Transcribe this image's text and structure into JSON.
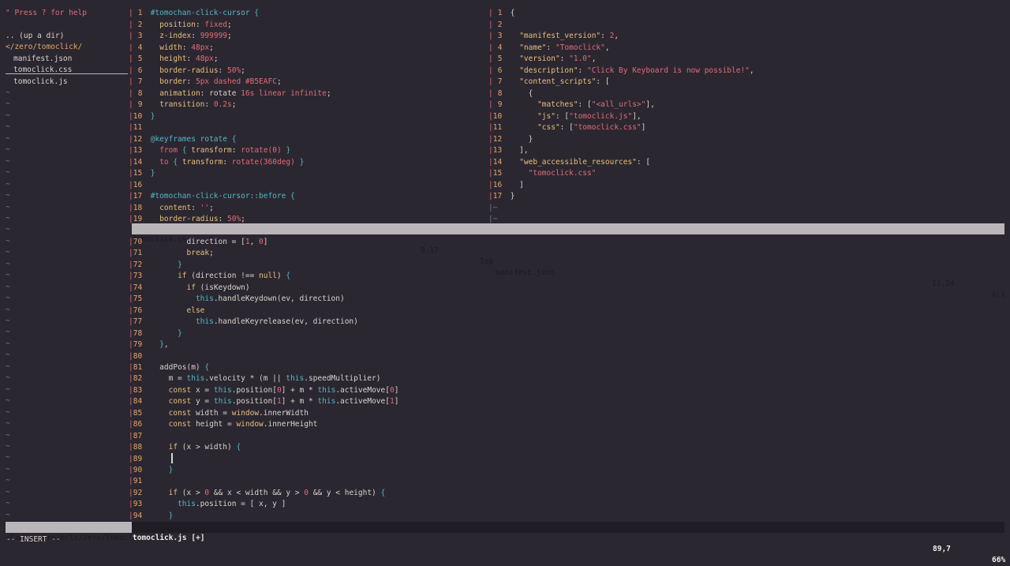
{
  "tree": {
    "help": "\" Press ? for help",
    "up_dir": ".. (up a dir)",
    "current_dir": "</zero/tomoclick/",
    "files": [
      "manifest.json",
      "tomoclick.css",
      "tomoclick.js"
    ],
    "tilde": "~"
  },
  "css_pane": {
    "lines": [
      {
        "n": "1",
        "t": [
          [
            "tk-sel",
            "#tomochan-click-cursor "
          ],
          [
            "tk-brace",
            "{"
          ]
        ]
      },
      {
        "n": "2",
        "t": [
          [
            "tk-plain",
            "  "
          ],
          [
            "tk-prop",
            "position"
          ],
          [
            "tk-punc",
            ": "
          ],
          [
            "tk-str",
            "fixed"
          ],
          [
            "tk-punc",
            ";"
          ]
        ]
      },
      {
        "n": "3",
        "t": [
          [
            "tk-plain",
            "  "
          ],
          [
            "tk-prop",
            "z-index"
          ],
          [
            "tk-punc",
            ": "
          ],
          [
            "tk-num",
            "999999"
          ],
          [
            "tk-punc",
            ";"
          ]
        ]
      },
      {
        "n": "4",
        "t": [
          [
            "tk-plain",
            "  "
          ],
          [
            "tk-prop",
            "width"
          ],
          [
            "tk-punc",
            ": "
          ],
          [
            "tk-num",
            "48px"
          ],
          [
            "tk-punc",
            ";"
          ]
        ]
      },
      {
        "n": "5",
        "t": [
          [
            "tk-plain",
            "  "
          ],
          [
            "tk-prop",
            "height"
          ],
          [
            "tk-punc",
            ": "
          ],
          [
            "tk-num",
            "48px"
          ],
          [
            "tk-punc",
            ";"
          ]
        ]
      },
      {
        "n": "6",
        "t": [
          [
            "tk-plain",
            "  "
          ],
          [
            "tk-prop",
            "border-radius"
          ],
          [
            "tk-punc",
            ": "
          ],
          [
            "tk-num",
            "50%"
          ],
          [
            "tk-punc",
            ";"
          ]
        ]
      },
      {
        "n": "7",
        "t": [
          [
            "tk-plain",
            "  "
          ],
          [
            "tk-prop",
            "border"
          ],
          [
            "tk-punc",
            ": "
          ],
          [
            "tk-num",
            "5px"
          ],
          [
            "tk-str",
            " dashed #B5EAFC"
          ],
          [
            "tk-punc",
            ";"
          ]
        ]
      },
      {
        "n": "8",
        "t": [
          [
            "tk-plain",
            "  "
          ],
          [
            "tk-prop",
            "animation"
          ],
          [
            "tk-punc",
            ": rotate "
          ],
          [
            "tk-num",
            "16s"
          ],
          [
            "tk-str",
            " linear infinite"
          ],
          [
            "tk-punc",
            ";"
          ]
        ]
      },
      {
        "n": "9",
        "t": [
          [
            "tk-plain",
            "  "
          ],
          [
            "tk-prop",
            "transition"
          ],
          [
            "tk-punc",
            ": "
          ],
          [
            "tk-num",
            "0.2s"
          ],
          [
            "tk-punc",
            ";"
          ]
        ]
      },
      {
        "n": "10",
        "t": [
          [
            "tk-brace",
            "}"
          ]
        ]
      },
      {
        "n": "11",
        "t": []
      },
      {
        "n": "12",
        "t": [
          [
            "tk-fn",
            "@keyframes rotate "
          ],
          [
            "tk-brace",
            "{"
          ]
        ]
      },
      {
        "n": "13",
        "t": [
          [
            "tk-plain",
            "  "
          ],
          [
            "tk-str",
            "from"
          ],
          [
            "tk-plain",
            " "
          ],
          [
            "tk-brace",
            "{"
          ],
          [
            "tk-plain",
            " "
          ],
          [
            "tk-prop",
            "transform"
          ],
          [
            "tk-punc",
            ": "
          ],
          [
            "tk-str",
            "rotate(0)"
          ],
          [
            "tk-plain",
            " "
          ],
          [
            "tk-brace",
            "}"
          ]
        ]
      },
      {
        "n": "14",
        "t": [
          [
            "tk-plain",
            "  "
          ],
          [
            "tk-str",
            "to"
          ],
          [
            "tk-plain",
            " "
          ],
          [
            "tk-brace",
            "{"
          ],
          [
            "tk-plain",
            " "
          ],
          [
            "tk-prop",
            "transform"
          ],
          [
            "tk-punc",
            ": "
          ],
          [
            "tk-str",
            "rotate(360deg)"
          ],
          [
            "tk-plain",
            " "
          ],
          [
            "tk-brace",
            "}"
          ]
        ]
      },
      {
        "n": "15",
        "t": [
          [
            "tk-brace",
            "}"
          ]
        ]
      },
      {
        "n": "16",
        "t": []
      },
      {
        "n": "17",
        "t": [
          [
            "tk-sel",
            "#tomochan-click-cursor::before "
          ],
          [
            "tk-brace",
            "{"
          ]
        ]
      },
      {
        "n": "18",
        "t": [
          [
            "tk-plain",
            "  "
          ],
          [
            "tk-prop",
            "content"
          ],
          [
            "tk-punc",
            ": "
          ],
          [
            "tk-str",
            "''"
          ],
          [
            "tk-punc",
            ";"
          ]
        ]
      },
      {
        "n": "19",
        "t": [
          [
            "tk-plain",
            "  "
          ],
          [
            "tk-prop",
            "border-radius"
          ],
          [
            "tk-punc",
            ": "
          ],
          [
            "tk-num",
            "50%"
          ],
          [
            "tk-punc",
            ";"
          ]
        ]
      }
    ]
  },
  "json_pane": {
    "lines": [
      {
        "n": "1",
        "t": [
          [
            "tk-punc",
            "{"
          ]
        ]
      },
      {
        "n": "2",
        "t": []
      },
      {
        "n": "3",
        "t": [
          [
            "tk-plain",
            "  "
          ],
          [
            "tk-prop",
            "\"manifest_version\""
          ],
          [
            "tk-punc",
            ": "
          ],
          [
            "tk-num",
            "2"
          ],
          [
            "tk-punc",
            ","
          ]
        ]
      },
      {
        "n": "4",
        "t": [
          [
            "tk-plain",
            "  "
          ],
          [
            "tk-prop",
            "\"name\""
          ],
          [
            "tk-punc",
            ": "
          ],
          [
            "tk-str",
            "\"Tomoclick\""
          ],
          [
            "tk-punc",
            ","
          ]
        ]
      },
      {
        "n": "5",
        "t": [
          [
            "tk-plain",
            "  "
          ],
          [
            "tk-prop",
            "\"version\""
          ],
          [
            "tk-punc",
            ": "
          ],
          [
            "tk-str",
            "\"1.0\""
          ],
          [
            "tk-punc",
            ","
          ]
        ]
      },
      {
        "n": "6",
        "t": [
          [
            "tk-plain",
            "  "
          ],
          [
            "tk-prop",
            "\"description\""
          ],
          [
            "tk-punc",
            ": "
          ],
          [
            "tk-str",
            "\"Click By Keyboard is now possible!\""
          ],
          [
            "tk-punc",
            ","
          ]
        ]
      },
      {
        "n": "7",
        "t": [
          [
            "tk-plain",
            "  "
          ],
          [
            "tk-prop",
            "\"content_scripts\""
          ],
          [
            "tk-punc",
            ": ["
          ]
        ]
      },
      {
        "n": "8",
        "t": [
          [
            "tk-plain",
            "    {"
          ]
        ]
      },
      {
        "n": "9",
        "t": [
          [
            "tk-plain",
            "      "
          ],
          [
            "tk-prop",
            "\"matches\""
          ],
          [
            "tk-punc",
            ": ["
          ],
          [
            "tk-str",
            "\"<all_urls>\""
          ],
          [
            "tk-punc",
            "],"
          ]
        ]
      },
      {
        "n": "10",
        "t": [
          [
            "tk-plain",
            "      "
          ],
          [
            "tk-prop",
            "\"js\""
          ],
          [
            "tk-punc",
            ": ["
          ],
          [
            "tk-str",
            "\"tomoclick.js\""
          ],
          [
            "tk-punc",
            "],"
          ]
        ]
      },
      {
        "n": "11",
        "t": [
          [
            "tk-plain",
            "      "
          ],
          [
            "tk-prop",
            "\"css\""
          ],
          [
            "tk-punc",
            ": ["
          ],
          [
            "tk-str",
            "\"tomoclick.css\""
          ],
          [
            "tk-punc",
            "]"
          ]
        ]
      },
      {
        "n": "12",
        "t": [
          [
            "tk-plain",
            "    }"
          ]
        ]
      },
      {
        "n": "13",
        "t": [
          [
            "tk-plain",
            "  ],"
          ]
        ]
      },
      {
        "n": "14",
        "t": [
          [
            "tk-plain",
            "  "
          ],
          [
            "tk-prop",
            "\"web_accessible_resources\""
          ],
          [
            "tk-punc",
            ": ["
          ]
        ]
      },
      {
        "n": "15",
        "t": [
          [
            "tk-plain",
            "    "
          ],
          [
            "tk-str",
            "\"tomoclick.css\""
          ]
        ]
      },
      {
        "n": "16",
        "t": [
          [
            "tk-plain",
            "  ]"
          ]
        ]
      },
      {
        "n": "17",
        "t": [
          [
            "tk-punc",
            "}"
          ]
        ]
      }
    ],
    "tilde_count": 2
  },
  "js_pane": {
    "lines": [
      {
        "n": "70",
        "t": [
          [
            "tk-plain",
            "        direction = ["
          ],
          [
            "tk-num",
            "1"
          ],
          [
            "tk-plain",
            ", "
          ],
          [
            "tk-num",
            "0"
          ],
          [
            "tk-plain",
            "]"
          ]
        ]
      },
      {
        "n": "71",
        "t": [
          [
            "tk-plain",
            "        "
          ],
          [
            "tk-kw",
            "break"
          ],
          [
            "tk-plain",
            ";"
          ]
        ]
      },
      {
        "n": "72",
        "t": [
          [
            "tk-plain",
            "      "
          ],
          [
            "tk-brace",
            "}"
          ]
        ]
      },
      {
        "n": "73",
        "t": [
          [
            "tk-plain",
            "      "
          ],
          [
            "tk-kw",
            "if"
          ],
          [
            "tk-plain",
            " (direction !== "
          ],
          [
            "tk-kw",
            "null"
          ],
          [
            "tk-plain",
            ") "
          ],
          [
            "tk-brace",
            "{"
          ]
        ]
      },
      {
        "n": "74",
        "t": [
          [
            "tk-plain",
            "        "
          ],
          [
            "tk-kw",
            "if"
          ],
          [
            "tk-plain",
            " (isKeydown)"
          ]
        ]
      },
      {
        "n": "75",
        "t": [
          [
            "tk-plain",
            "          "
          ],
          [
            "tk-this",
            "this"
          ],
          [
            "tk-plain",
            ".handleKeydown(ev, direction)"
          ]
        ]
      },
      {
        "n": "76",
        "t": [
          [
            "tk-plain",
            "        "
          ],
          [
            "tk-kw",
            "else"
          ]
        ]
      },
      {
        "n": "77",
        "t": [
          [
            "tk-plain",
            "          "
          ],
          [
            "tk-this",
            "this"
          ],
          [
            "tk-plain",
            ".handleKeyrelease(ev, direction)"
          ]
        ]
      },
      {
        "n": "78",
        "t": [
          [
            "tk-plain",
            "      "
          ],
          [
            "tk-brace",
            "}"
          ]
        ]
      },
      {
        "n": "79",
        "t": [
          [
            "tk-plain",
            "  "
          ],
          [
            "tk-brace",
            "}"
          ],
          [
            "tk-plain",
            ","
          ]
        ]
      },
      {
        "n": "80",
        "t": []
      },
      {
        "n": "81",
        "t": [
          [
            "tk-plain",
            "  addPos(m) "
          ],
          [
            "tk-brace",
            "{"
          ]
        ]
      },
      {
        "n": "82",
        "t": [
          [
            "tk-plain",
            "    m = "
          ],
          [
            "tk-this",
            "this"
          ],
          [
            "tk-plain",
            ".velocity * (m || "
          ],
          [
            "tk-this",
            "this"
          ],
          [
            "tk-plain",
            ".speedMultiplier)"
          ]
        ]
      },
      {
        "n": "83",
        "t": [
          [
            "tk-plain",
            "    "
          ],
          [
            "tk-kw",
            "const"
          ],
          [
            "tk-plain",
            " x = "
          ],
          [
            "tk-this",
            "this"
          ],
          [
            "tk-plain",
            ".position["
          ],
          [
            "tk-num",
            "0"
          ],
          [
            "tk-plain",
            "] + m * "
          ],
          [
            "tk-this",
            "this"
          ],
          [
            "tk-plain",
            ".activeMove["
          ],
          [
            "tk-num",
            "0"
          ],
          [
            "tk-plain",
            "]"
          ]
        ]
      },
      {
        "n": "84",
        "t": [
          [
            "tk-plain",
            "    "
          ],
          [
            "tk-kw",
            "const"
          ],
          [
            "tk-plain",
            " y = "
          ],
          [
            "tk-this",
            "this"
          ],
          [
            "tk-plain",
            ".position["
          ],
          [
            "tk-num",
            "1"
          ],
          [
            "tk-plain",
            "] + m * "
          ],
          [
            "tk-this",
            "this"
          ],
          [
            "tk-plain",
            ".activeMove["
          ],
          [
            "tk-num",
            "1"
          ],
          [
            "tk-plain",
            "]"
          ]
        ]
      },
      {
        "n": "85",
        "t": [
          [
            "tk-plain",
            "    "
          ],
          [
            "tk-kw",
            "const"
          ],
          [
            "tk-plain",
            " width = "
          ],
          [
            "tk-kw",
            "window"
          ],
          [
            "tk-plain",
            ".innerWidth"
          ]
        ]
      },
      {
        "n": "86",
        "t": [
          [
            "tk-plain",
            "    "
          ],
          [
            "tk-kw",
            "const"
          ],
          [
            "tk-plain",
            " height = "
          ],
          [
            "tk-kw",
            "window"
          ],
          [
            "tk-plain",
            ".innerHeight"
          ]
        ]
      },
      {
        "n": "87",
        "t": []
      },
      {
        "n": "88",
        "t": [
          [
            "tk-plain",
            "    "
          ],
          [
            "tk-kw",
            "if"
          ],
          [
            "tk-plain",
            " (x > width) "
          ],
          [
            "tk-brace",
            "{"
          ]
        ]
      },
      {
        "n": "89",
        "t": []
      },
      {
        "n": "90",
        "t": [
          [
            "tk-plain",
            "    "
          ],
          [
            "tk-brace",
            "}"
          ]
        ]
      },
      {
        "n": "91",
        "t": []
      },
      {
        "n": "92",
        "t": [
          [
            "tk-plain",
            "    "
          ],
          [
            "tk-kw",
            "if"
          ],
          [
            "tk-plain",
            " (x > "
          ],
          [
            "tk-num",
            "0"
          ],
          [
            "tk-plain",
            " && x < width && y > "
          ],
          [
            "tk-num",
            "0"
          ],
          [
            "tk-plain",
            " && y < height) "
          ],
          [
            "tk-brace",
            "{"
          ]
        ]
      },
      {
        "n": "93",
        "t": [
          [
            "tk-plain",
            "      "
          ],
          [
            "tk-this",
            "this"
          ],
          [
            "tk-plain",
            ".position = [ x, y ]"
          ]
        ]
      },
      {
        "n": "94",
        "t": [
          [
            "tk-plain",
            "    "
          ],
          [
            "tk-brace",
            "}"
          ]
        ]
      }
    ]
  },
  "status": {
    "css_file": "tomoclick.css",
    "css_pos": "9,17",
    "css_scroll": "Top",
    "json_file": "manifest.json",
    "json_pos": "11,24",
    "json_scroll": "All",
    "tree_path": "<Coding Projects/zero/tomoclick",
    "js_file": "tomoclick.js [+]",
    "js_pos": "89,7",
    "js_scroll": "66%"
  },
  "mode": "-- INSERT --"
}
